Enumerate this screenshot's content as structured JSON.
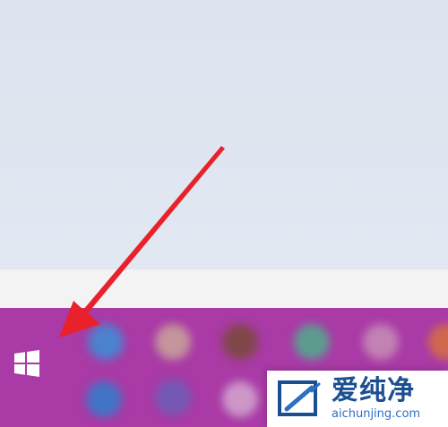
{
  "taskbar": {
    "start_button": {
      "icon": "windows-logo-icon",
      "color": "#ffffff"
    },
    "background_color": "#a93aa6"
  },
  "annotation": {
    "type": "arrow",
    "color": "#e8212a",
    "target": "start-button"
  },
  "watermark": {
    "title": "爱纯净",
    "url": "aichunjing.com",
    "color": "#1c4f91"
  }
}
